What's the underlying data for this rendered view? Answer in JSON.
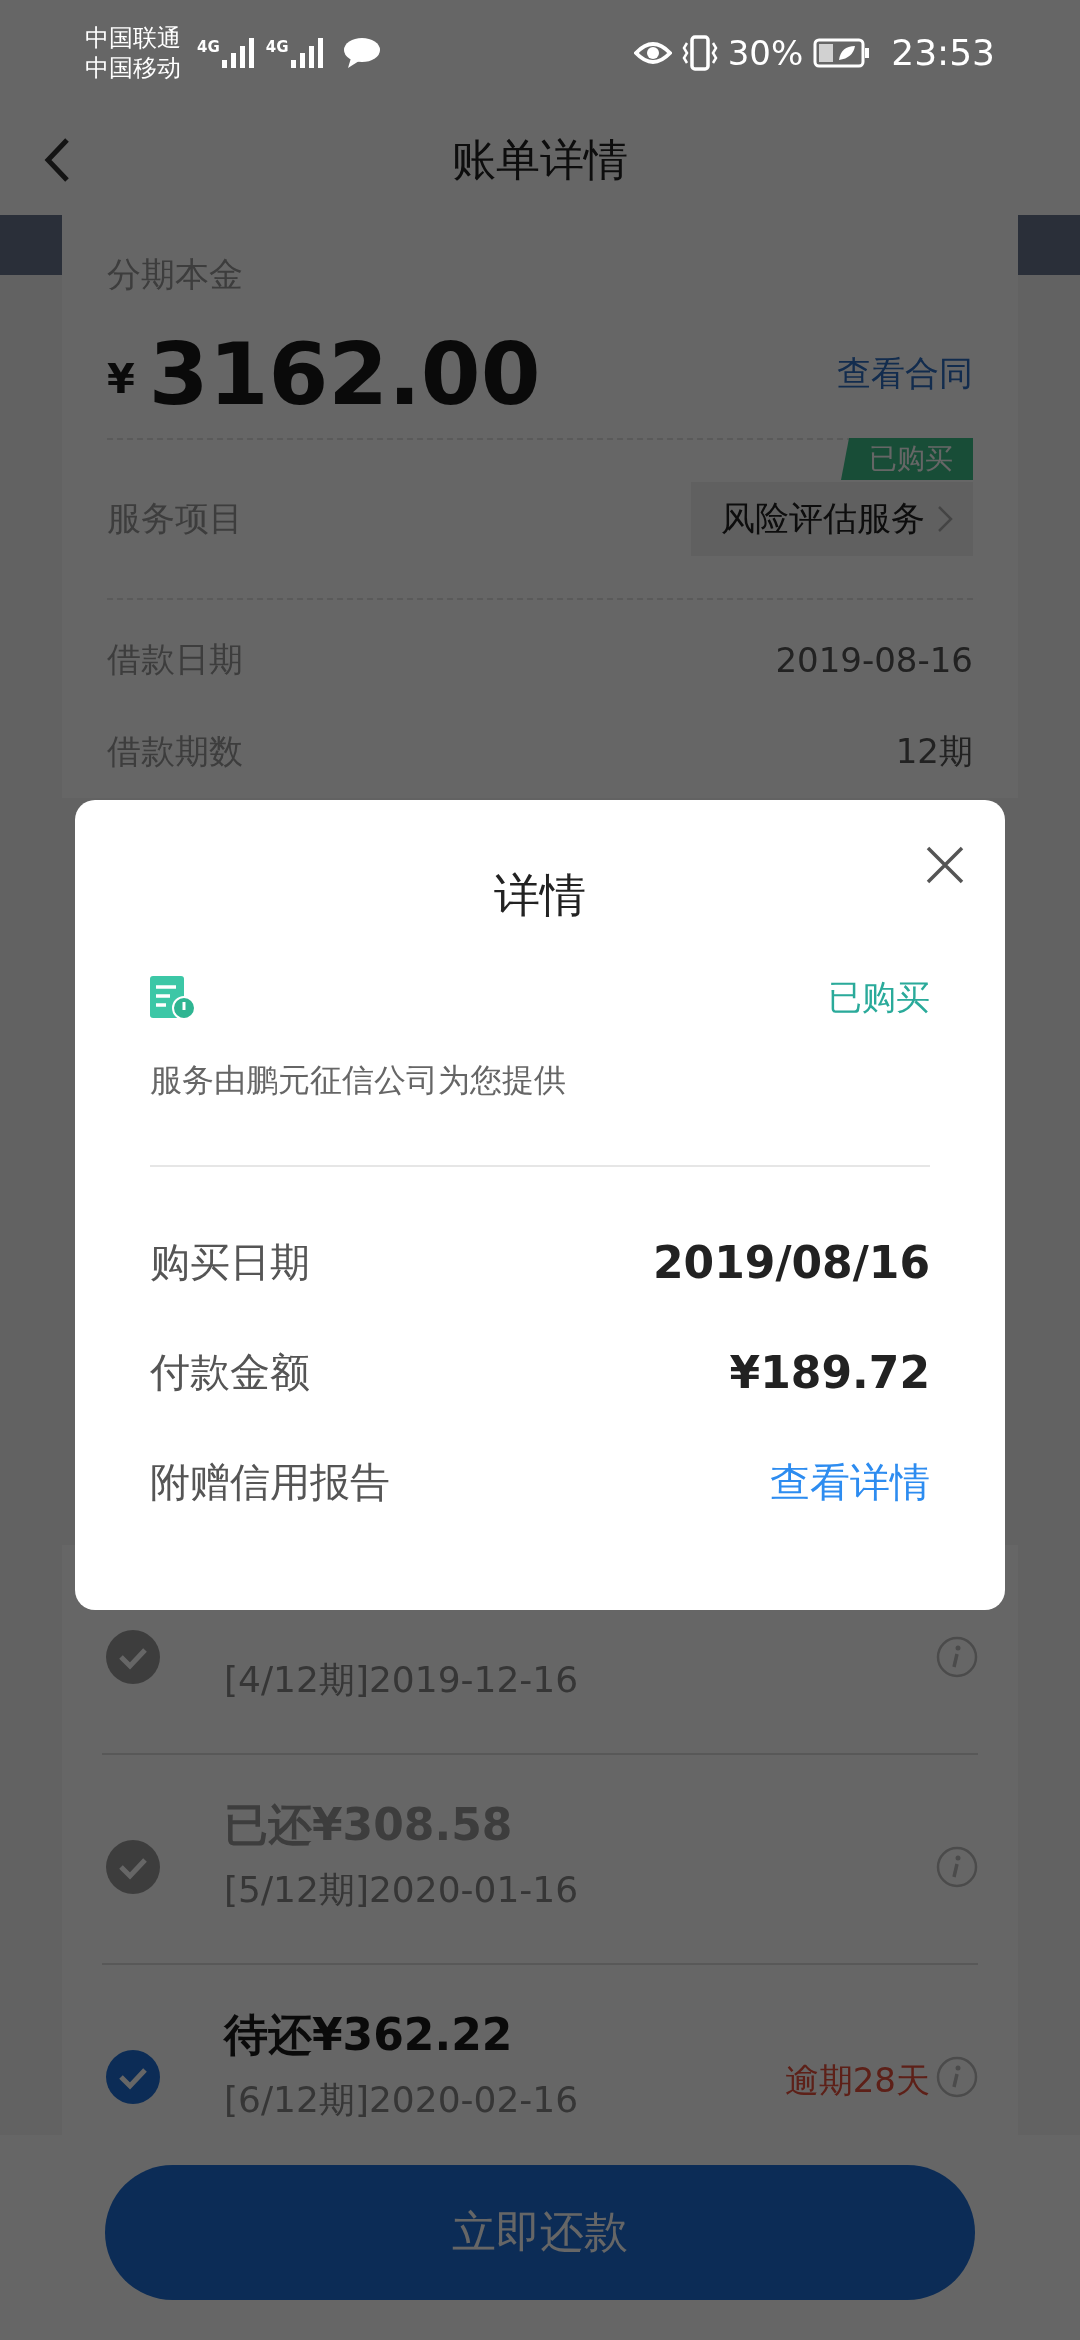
{
  "status_bar": {
    "carriers": [
      "中国联通",
      "中国移动"
    ],
    "networks": [
      "4G",
      "4G"
    ],
    "battery": "30%",
    "time": "23:53"
  },
  "header": {
    "title": "账单详情"
  },
  "summary": {
    "principal_label": "分期本金",
    "currency": "¥",
    "principal": "3162.00",
    "contract_link": "查看合同",
    "service_label": "服务项目",
    "service_name": "风险评估服务",
    "service_badge": "已购买",
    "rows": [
      {
        "label": "借款日期",
        "value": "2019-08-16"
      },
      {
        "label": "借款期数",
        "value": "12期"
      }
    ]
  },
  "installments": [
    {
      "period": "[4/12期]2019-12-16",
      "selected": false
    },
    {
      "amount": "已还¥308.58",
      "period": "[5/12期]2020-01-16",
      "paid": true,
      "selected": false
    },
    {
      "amount": "待还¥362.22",
      "period": "[6/12期]2020-02-16",
      "paid": false,
      "note": "逾期28天",
      "selected": true
    }
  ],
  "pay_button": "立即还款",
  "dialog": {
    "title": "详情",
    "status": "已购买",
    "provider": "服务由鹏元征信公司为您提供",
    "rows": [
      {
        "label": "购买日期",
        "value": "2019/08/16",
        "kind": "text"
      },
      {
        "label": "付款金额",
        "value": "¥189.72",
        "kind": "text"
      },
      {
        "label": "附赠信用报告",
        "value": "查看详情",
        "kind": "link"
      }
    ]
  }
}
